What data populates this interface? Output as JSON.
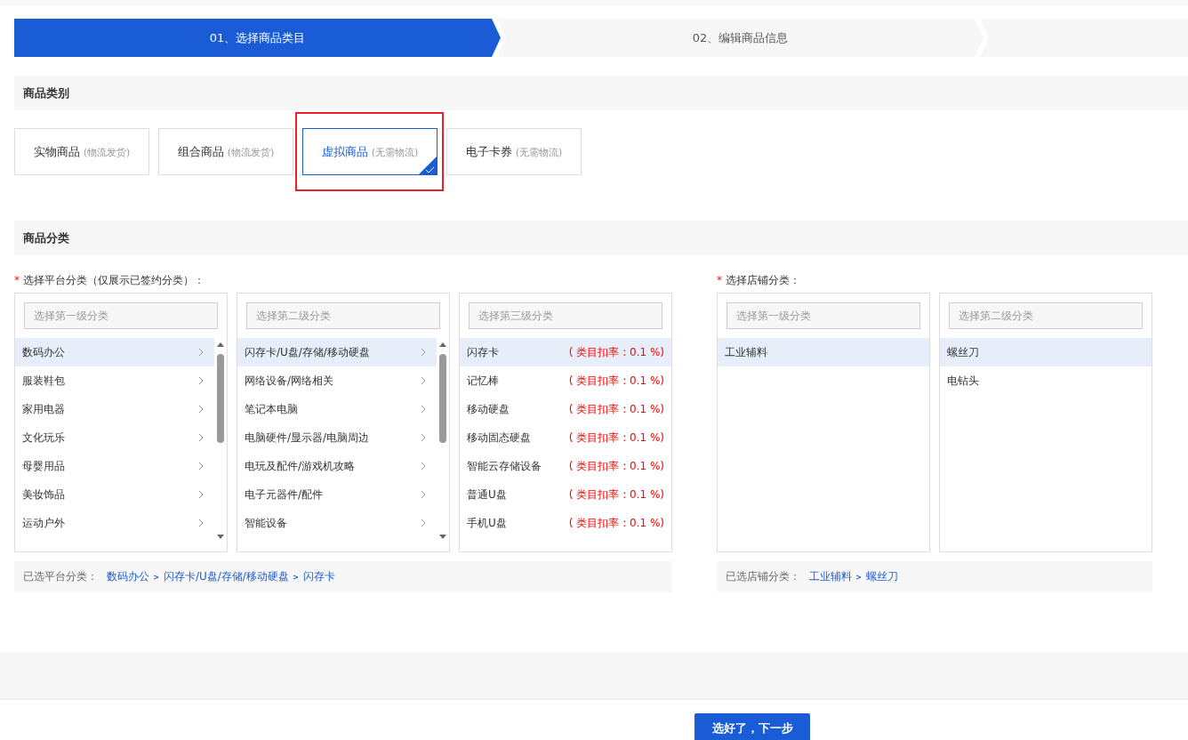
{
  "steps": [
    {
      "label": "01、选择商品类目",
      "selected": true
    },
    {
      "label": "02、编辑商品信息",
      "selected": false
    },
    {
      "selected": false
    }
  ],
  "type_section": {
    "title": "商品类别",
    "options": [
      {
        "name": "实物商品",
        "note": "(物流发货)",
        "selected": false
      },
      {
        "name": "组合商品",
        "note": "(物流发货)",
        "selected": false
      },
      {
        "name": "虚拟商品",
        "note": "(无需物流)",
        "selected": true
      },
      {
        "name": "电子卡券",
        "note": "(无需物流)",
        "selected": false
      }
    ]
  },
  "category_section": {
    "title": "商品分类",
    "platform": {
      "required_mark": "*",
      "label": "选择平台分类（仅展示已签约分类）：",
      "columns": [
        {
          "placeholder": "选择第一级分类",
          "scroll": true,
          "items": [
            {
              "name": "数码办公",
              "selected": true
            },
            {
              "name": "服装鞋包",
              "selected": false
            },
            {
              "name": "家用电器",
              "selected": false
            },
            {
              "name": "文化玩乐",
              "selected": false
            },
            {
              "name": "母婴用品",
              "selected": false
            },
            {
              "name": "美妆饰品",
              "selected": false
            },
            {
              "name": "运动户外",
              "selected": false
            }
          ]
        },
        {
          "placeholder": "选择第二级分类",
          "scroll": true,
          "items": [
            {
              "name": "闪存卡/U盘/存储/移动硬盘",
              "selected": true
            },
            {
              "name": "网络设备/网络相关",
              "selected": false
            },
            {
              "name": "笔记本电脑",
              "selected": false
            },
            {
              "name": "电脑硬件/显示器/电脑周边",
              "selected": false
            },
            {
              "name": "电玩及配件/游戏机攻略",
              "selected": false
            },
            {
              "name": "电子元器件/配件",
              "selected": false
            },
            {
              "name": "智能设备",
              "selected": false
            }
          ]
        },
        {
          "placeholder": "选择第三级分类",
          "scroll": false,
          "items": [
            {
              "name": "闪存卡",
              "rate": "( 类目扣率 : 0.1 %)",
              "selected": true
            },
            {
              "name": "记忆棒",
              "rate": "( 类目扣率 : 0.1 %)",
              "selected": false
            },
            {
              "name": "移动硬盘",
              "rate": "( 类目扣率 : 0.1 %)",
              "selected": false
            },
            {
              "name": "移动固态硬盘",
              "rate": "( 类目扣率 : 0.1 %)",
              "selected": false
            },
            {
              "name": "智能云存储设备",
              "rate": "( 类目扣率 : 0.1 %)",
              "selected": false
            },
            {
              "name": "普通U盘",
              "rate": "( 类目扣率 : 0.1 %)",
              "selected": false
            },
            {
              "name": "手机U盘",
              "rate": "( 类目扣率 : 0.1 %)",
              "selected": false
            }
          ]
        }
      ],
      "selected_label": "已选平台分类：",
      "path": [
        "数码办公",
        "闪存卡/U盘/存储/移动硬盘",
        "闪存卡"
      ]
    },
    "store": {
      "required_mark": "*",
      "label": "选择店铺分类：",
      "columns": [
        {
          "placeholder": "选择第一级分类",
          "scroll": false,
          "items": [
            {
              "name": "工业辅料",
              "selected": true
            }
          ]
        },
        {
          "placeholder": "选择第二级分类",
          "scroll": false,
          "items": [
            {
              "name": "螺丝刀",
              "selected": true
            },
            {
              "name": "电钻头",
              "selected": false
            }
          ]
        }
      ],
      "selected_label": "已选店铺分类：",
      "path": [
        "工业辅料",
        "螺丝刀"
      ]
    }
  },
  "next_button": "选好了，下一步"
}
